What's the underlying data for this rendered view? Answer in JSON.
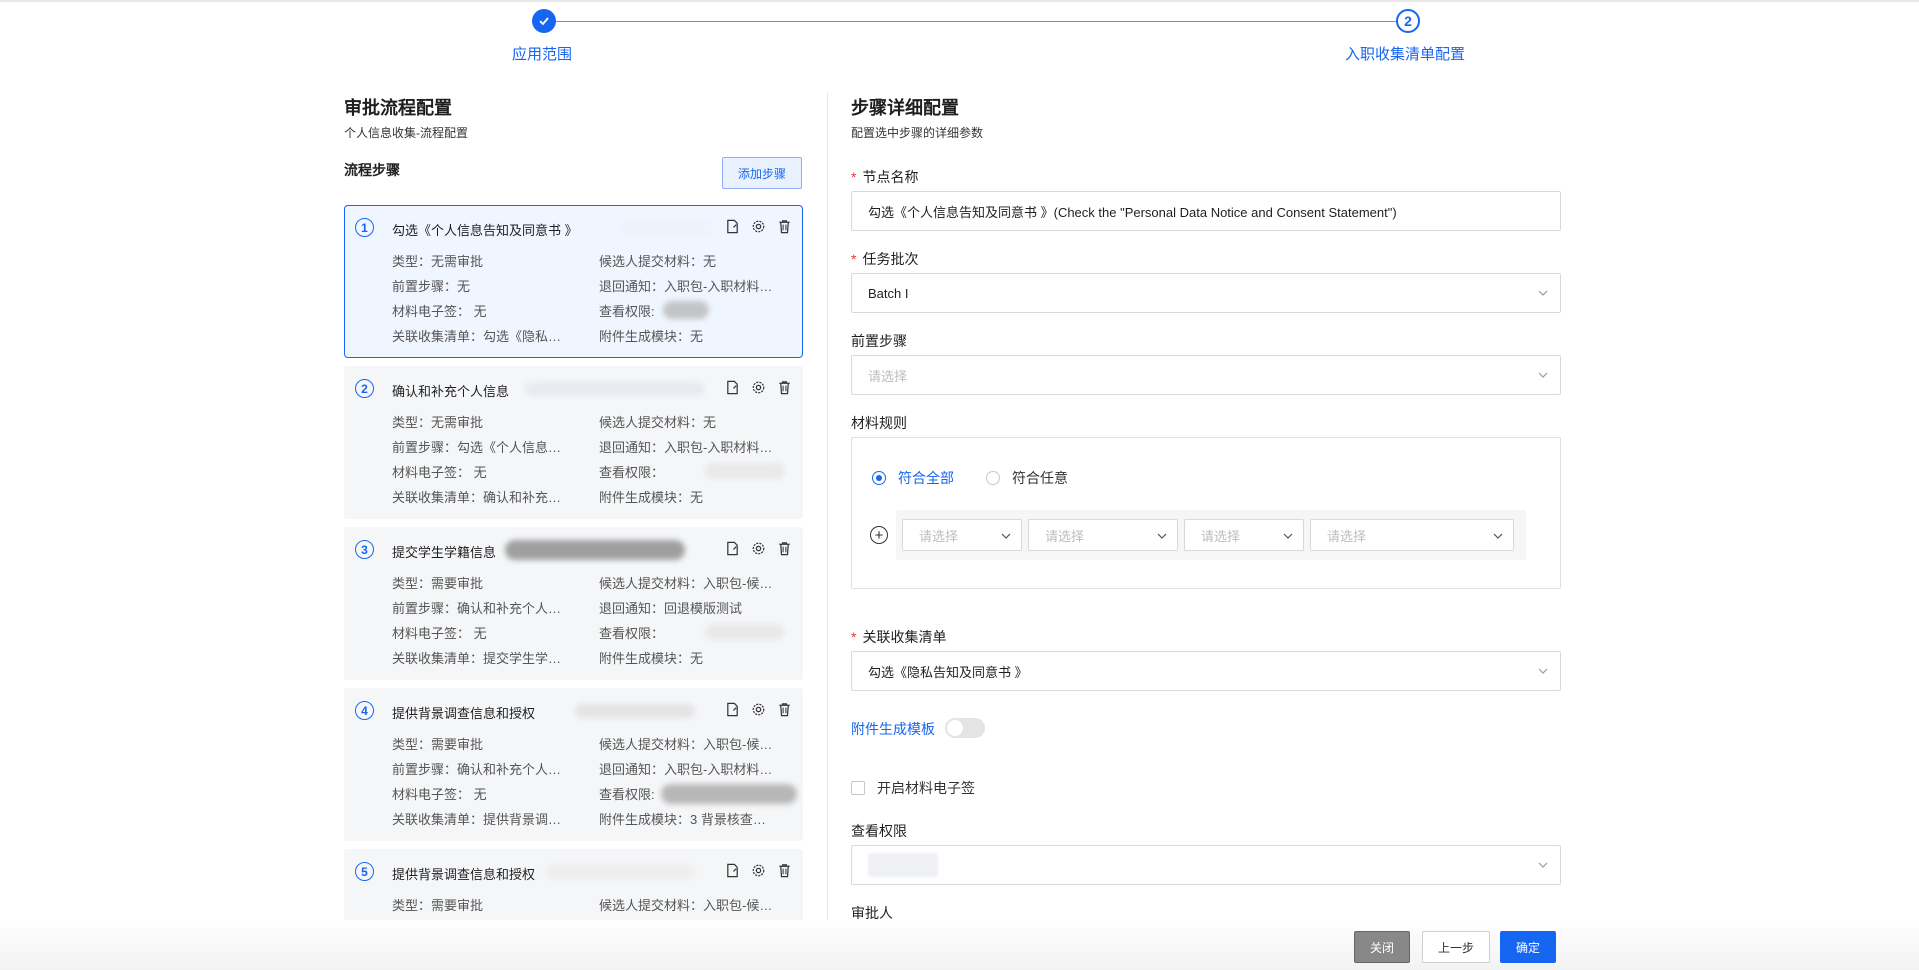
{
  "stepper": {
    "step1": {
      "number": "✓",
      "label": "应用范围"
    },
    "step2": {
      "number": "2",
      "label": "入职收集清单配置"
    }
  },
  "left": {
    "title": "审批流程配置",
    "subtitle": "个人信息收集-流程配置",
    "flow_label": "流程步骤",
    "add_button": "添加步骤",
    "cards": [
      {
        "num": "1",
        "title": "勾选《个人信息告知及同意书 》",
        "type": "类型：无需审批",
        "candidate": "候选人提交材料：无",
        "pre": "前置步骤：无",
        "return": "退回通知：入职包-入职材料…",
        "esign": "材料电子签：  无",
        "perm": "查看权限:",
        "list": "关联收集清单：勾选《隐私…",
        "attach": "附件生成模块：无"
      },
      {
        "num": "2",
        "title": "确认和补充个人信息",
        "type": "类型：无需审批",
        "candidate": "候选人提交材料：无",
        "pre": "前置步骤：勾选《个人信息…",
        "return": "退回通知：入职包-入职材料…",
        "esign": "材料电子签：  无",
        "perm": "查看权限：",
        "list": "关联收集清单：确认和补充…",
        "attach": "附件生成模块：无"
      },
      {
        "num": "3",
        "title": "提交学生学籍信息",
        "type": "类型：需要审批",
        "candidate": "候选人提交材料：入职包-候…",
        "pre": "前置步骤：确认和补充个人…",
        "return": "退回通知：回退模版测试",
        "esign": "材料电子签：  无",
        "perm": "查看权限：",
        "list": "关联收集清单：提交学生学…",
        "attach": "附件生成模块：无"
      },
      {
        "num": "4",
        "title": "提供背景调查信息和授权",
        "type": "类型：需要审批",
        "candidate": "候选人提交材料：入职包-候…",
        "pre": "前置步骤：确认和补充个人…",
        "return": "退回通知：入职包-入职材料…",
        "esign": "材料电子签：  无",
        "perm": "查看权限:",
        "list": "关联收集清单：提供背景调…",
        "attach": "附件生成模块：3 背景核查…"
      },
      {
        "num": "5",
        "title": "提供背景调查信息和授权",
        "type": "类型：需要审批",
        "candidate": "候选人提交材料：入职包-候…"
      }
    ]
  },
  "right": {
    "title": "步骤详细配置",
    "subtitle": "配置选中步骤的详细参数",
    "node_name_label": "节点名称",
    "node_name_value": "勾选《个人信息告知及同意书 》(Check the \"Personal Data Notice and Consent Statement\")",
    "batch_label": "任务批次",
    "batch_value": "Batch I",
    "pre_label": "前置步骤",
    "pre_placeholder": "请选择",
    "rules_label": "材料规则",
    "rule_all": "符合全部",
    "rule_any": "符合任意",
    "rule_selects": [
      "请选择",
      "请选择",
      "请选择",
      "请选择"
    ],
    "list_label": "关联收集清单",
    "list_value": "勾选《隐私告知及同意书 》",
    "attach_label": "附件生成模板",
    "esign_label": "开启材料电子签",
    "perm_label": "查看权限",
    "approver_label": "审批人"
  },
  "footer": {
    "close": "关闭",
    "prev": "上一步",
    "ok": "确定"
  },
  "colors": {
    "primary": "#1766f2",
    "required": "#e53935"
  }
}
